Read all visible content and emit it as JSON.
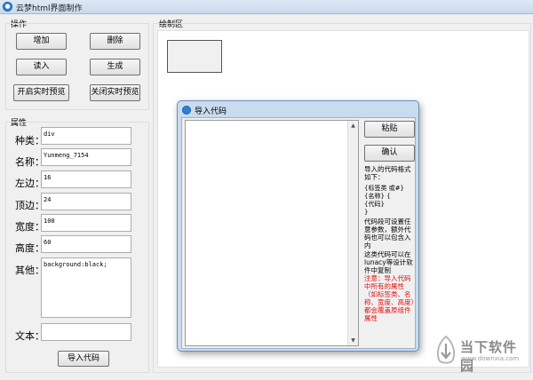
{
  "window": {
    "title": "云梦html界面制作",
    "icon": "app-logo-icon"
  },
  "ops": {
    "group_label": "操作",
    "add": "增加",
    "delete": "删除",
    "read": "读入",
    "generate": "生成",
    "start_preview": "开启实时预览",
    "stop_preview": "关闭实时预览"
  },
  "props": {
    "group_label": "属性",
    "type_label": "种类：",
    "type_value": "div",
    "name_label": "名称：",
    "name_value": "Yunmeng_7154",
    "left_label": "左边：",
    "left_value": "16",
    "top_label": "顶边：",
    "top_value": "24",
    "width_label": "宽度：",
    "width_value": "100",
    "height_label": "高度：",
    "height_value": "60",
    "other_label": "其他：",
    "other_value": "background:black;",
    "text_label": "文本：",
    "text_value": "",
    "import_button": "导入代码"
  },
  "canvas": {
    "group_label": "绘制区"
  },
  "dialog": {
    "title": "导入代码",
    "paste_button": "粘贴",
    "confirm_button": "确认",
    "help1": "导入的代码格式如下：",
    "help2": "{标签类 或#}\n{名称} {\n{代码}\n}",
    "help3": "代码段可设置任意参数，额外代码也可以包含入内",
    "help4": "这类代码可以在lunacy等设计软件中复制",
    "help5": "注意：导入代码中所有的属性（如标签类、名称、宽度、高度）都会覆盖原组件属性"
  },
  "watermark": {
    "brand": "当下软件园",
    "url": "www.downxia.com"
  }
}
